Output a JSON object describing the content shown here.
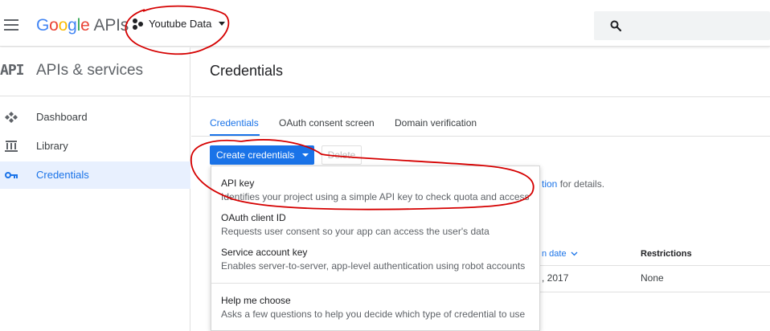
{
  "header": {
    "logo": {
      "G": "G",
      "o1": "o",
      "o2": "o",
      "g": "g",
      "l": "l",
      "e": "e",
      "apis": "APIs"
    },
    "project_name": "Youtube Data",
    "search_placeholder": ""
  },
  "sidebar": {
    "api_glyph": "API",
    "title": "APIs & services",
    "items": [
      {
        "label": "Dashboard",
        "icon": "dashboard-icon"
      },
      {
        "label": "Library",
        "icon": "library-icon"
      },
      {
        "label": "Credentials",
        "icon": "key-icon",
        "active": true
      }
    ]
  },
  "main": {
    "title": "Credentials",
    "tabs": [
      {
        "label": "Credentials",
        "active": true
      },
      {
        "label": "OAuth consent screen"
      },
      {
        "label": "Domain verification"
      }
    ],
    "create_button": "Create credentials",
    "delete_button": "Delete",
    "info": {
      "link": "tion",
      "rest": " for details."
    },
    "table": {
      "col_date": "n date",
      "col_restrictions": "Restrictions",
      "row_date": ", 2017",
      "row_restrictions": "None"
    }
  },
  "dropdown": {
    "items": [
      {
        "title": "API key",
        "desc": "Identifies your project using a simple API key to check quota and access"
      },
      {
        "title": "OAuth client ID",
        "desc": "Requests user consent so your app can access the user's data"
      },
      {
        "title": "Service account key",
        "desc": "Enables server-to-server, app-level authentication using robot accounts"
      },
      {
        "title": "Help me choose",
        "desc": "Asks a few questions to help you decide which type of credential to use"
      }
    ]
  },
  "colors": {
    "accent": "#1a73e8",
    "annotation": "#d50000",
    "active_nav_bg": "#e8f0fe"
  }
}
